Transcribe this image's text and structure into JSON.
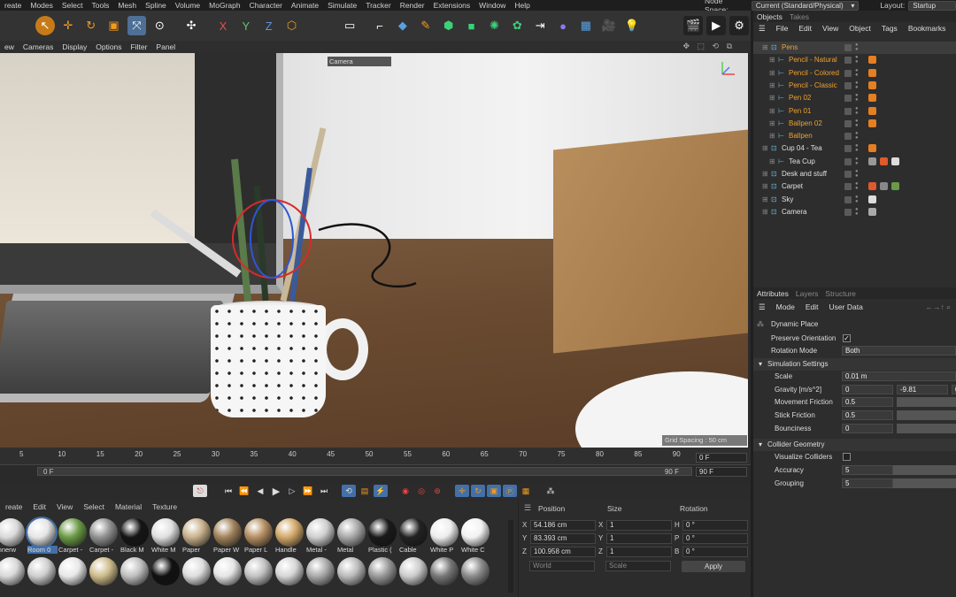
{
  "menubar": {
    "items": [
      "reate",
      "Modes",
      "Select",
      "Tools",
      "Mesh",
      "Spline",
      "Volume",
      "MoGraph",
      "Character",
      "Animate",
      "Simulate",
      "Tracker",
      "Render",
      "Extensions",
      "Window",
      "Help"
    ],
    "node_space_label": "Node Space:",
    "node_space_value": "Current (Standard/Physical)",
    "layout_label": "Layout:",
    "layout_value": "Startup"
  },
  "viewport_menu": {
    "items": [
      "ew",
      "Cameras",
      "Display",
      "Options",
      "Filter",
      "Panel"
    ]
  },
  "viewport": {
    "camera_tag": "Camera",
    "grid_spacing": "Grid Spacing : 50 cm"
  },
  "timeline": {
    "ticks": [
      "5",
      "10",
      "15",
      "20",
      "25",
      "30",
      "35",
      "40",
      "45",
      "50",
      "55",
      "60",
      "65",
      "70",
      "75",
      "80",
      "85",
      "90"
    ],
    "current_frame": "0 F",
    "range_start": "0 F",
    "range_end": "90 F",
    "max_frame": "90 F"
  },
  "materials": {
    "menu": [
      "reate",
      "Edit",
      "View",
      "Select",
      "Material",
      "Texture"
    ],
    "row1": [
      {
        "label": "innerw",
        "color": "#d9d9d9"
      },
      {
        "label": "Room 0",
        "color": "#e6e6e6"
      },
      {
        "label": "Carpet -",
        "color": "#6a9a45"
      },
      {
        "label": "Carpet -",
        "color": "#909090"
      },
      {
        "label": "Black M",
        "color": "#151515"
      },
      {
        "label": "White M",
        "color": "#e0e0e0"
      },
      {
        "label": "Paper",
        "color": "#c8b08a"
      },
      {
        "label": "Paper W",
        "color": "#a0825a"
      },
      {
        "label": "Paper L",
        "color": "#b48e62"
      },
      {
        "label": "Handle",
        "color": "#d2a86a"
      },
      {
        "label": "Metal -",
        "color": "#cfcfcf"
      },
      {
        "label": "Metal",
        "color": "#a8a8a8"
      },
      {
        "label": "Plastic (",
        "color": "#1a1a1a"
      },
      {
        "label": "Cable",
        "color": "#222222"
      },
      {
        "label": "White P",
        "color": "#eeeeee"
      },
      {
        "label": "White C",
        "color": "#f2f2f2"
      }
    ],
    "row2_colors": [
      "#d8d8d8",
      "#cfcfcf",
      "#e8e8e8",
      "#cdbb8a",
      "#bfbfbf",
      "#111111",
      "#dddddd",
      "#e5e5e5",
      "#c2c2c2",
      "#d6d6d6",
      "#aaaaaa",
      "#bbbbbb",
      "#999999",
      "#cccccc",
      "#777777",
      "#8a8a8a"
    ]
  },
  "coords": {
    "headers": {
      "position": "Position",
      "size": "Size",
      "rotation": "Rotation"
    },
    "rows": [
      {
        "axis": "X",
        "pos": "54.186 cm",
        "size_axis": "X",
        "size": "1",
        "rot_axis": "H",
        "rot": "0 °"
      },
      {
        "axis": "Y",
        "pos": "83.393 cm",
        "size_axis": "Y",
        "size": "1",
        "rot_axis": "P",
        "rot": "0 °"
      },
      {
        "axis": "Z",
        "pos": "100.958 cm",
        "size_axis": "Z",
        "size": "1",
        "rot_axis": "B",
        "rot": "0 °"
      }
    ],
    "mode_world": "World",
    "mode_scale": "Scale",
    "apply": "Apply"
  },
  "objects": {
    "tabs": [
      "Objects",
      "Takes"
    ],
    "menu": [
      "File",
      "Edit",
      "View",
      "Object",
      "Tags",
      "Bookmarks"
    ],
    "items": [
      {
        "name": "Pens",
        "color": "orange",
        "indent": 28,
        "tags": []
      },
      {
        "name": "Pencil - Natural",
        "color": "orange",
        "indent": 36,
        "tags": [
          "#e67e22"
        ]
      },
      {
        "name": "Pencil - Colored",
        "color": "orange",
        "indent": 36,
        "tags": [
          "#e67e22"
        ]
      },
      {
        "name": "Pencil - Classic",
        "color": "orange",
        "indent": 36,
        "tags": [
          "#e67e22"
        ]
      },
      {
        "name": "Pen 02",
        "color": "orange",
        "indent": 36,
        "tags": [
          "#e67e22"
        ]
      },
      {
        "name": "Pen 01",
        "color": "orange",
        "indent": 36,
        "tags": [
          "#e67e22"
        ]
      },
      {
        "name": "Ballpen 02",
        "color": "orange",
        "indent": 36,
        "tags": [
          "#e67e22"
        ]
      },
      {
        "name": "Ballpen",
        "color": "orange",
        "indent": 36,
        "tags": []
      },
      {
        "name": "Cup 04 - Tea",
        "color": "white",
        "indent": 28,
        "tags": [
          "#e67e22"
        ]
      },
      {
        "name": "Tea Cup",
        "color": "white",
        "indent": 36,
        "tags": [
          "#999",
          "#e05a2b",
          "#ddd"
        ]
      },
      {
        "name": "Desk and stuff",
        "color": "white",
        "indent": 28,
        "tags": []
      },
      {
        "name": "Carpet",
        "color": "white",
        "indent": 28,
        "tags": [
          "#e05a2b",
          "#888",
          "#6a9a45"
        ]
      },
      {
        "name": "Sky",
        "color": "white",
        "indent": 28,
        "tags": [
          "#ddd"
        ]
      },
      {
        "name": "Camera",
        "color": "white",
        "indent": 28,
        "tags": [
          "#aaa"
        ]
      }
    ]
  },
  "attributes": {
    "tabs": [
      "Attributes",
      "Layers",
      "Structure"
    ],
    "menu": [
      "Mode",
      "Edit",
      "User Data"
    ],
    "tag_name": "Dynamic Place",
    "preserve_orientation": "Preserve Orientation",
    "rotation_mode_label": "Rotation Mode",
    "rotation_mode_value": "Both",
    "sim_section": "Simulation Settings",
    "scale_label": "Scale",
    "scale_value": "0.01 m",
    "gravity_label": "Gravity [m/s^2]",
    "gravity_x": "0",
    "gravity_y": "-9.81",
    "gravity_z": "0",
    "move_friction_label": "Movement Friction",
    "move_friction": "0.5",
    "stick_friction_label": "Stick Friction",
    "stick_friction": "0.5",
    "bounciness_label": "Bounciness",
    "bounciness": "0",
    "collider_section": "Collider Geometry",
    "visualize_label": "Visualize Colliders",
    "accuracy_label": "Accuracy",
    "accuracy": "5",
    "grouping_label": "Grouping",
    "grouping": "5"
  }
}
